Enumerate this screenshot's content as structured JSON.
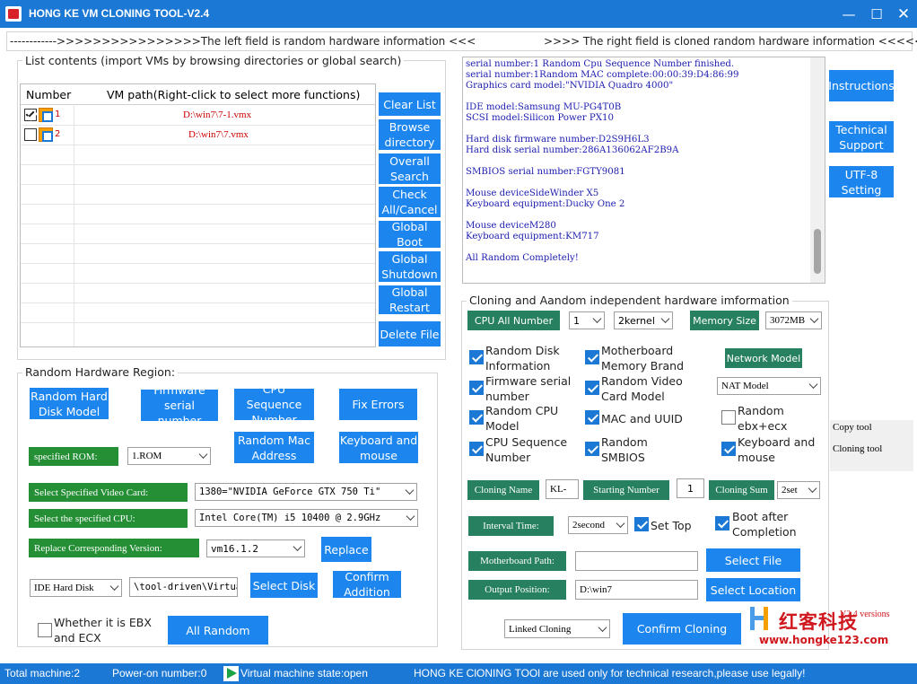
{
  "titlebar": {
    "title": "HONG KE VM CLONING TOOL-V2.4"
  },
  "banner": {
    "left": "------------>>>>>>>>>>>>>>>>The left field is random hardware information <<<",
    "right": ">>>> The right field is cloned random hardware information <<<<<<"
  },
  "list_section": {
    "legend": "List contents (import VMs by browsing directories or global search)",
    "col_number": "Number",
    "col_path": "VM path(Right-click to select more functions)",
    "rows": [
      {
        "number": "1",
        "path": "D:\\win7\\7-1.vmx",
        "checked": true
      },
      {
        "number": "2",
        "path": "D:\\win7\\7.vmx",
        "checked": false
      }
    ]
  },
  "list_buttons": {
    "clear": "Clear List",
    "browse": "Browse directory",
    "search": "Overall Search",
    "check": "Check All/Cancel",
    "boot": "Global Boot",
    "shutdown": "Global Shutdown",
    "restart": "Global Restart",
    "delete": "Delete File"
  },
  "log": {
    "text": "serial number:1 Random Cpu Sequence Number finished.\nserial number:1Random MAC complete:00:00:39:D4:86:99\nGraphics card model:\"NVIDIA Quadro 4000\"\n\nIDE model:Samsung MU-PG4T0B\nSCSI model:Silicon Power PX10\n\nHard disk firmware number:D2S9H6L3\nHard disk serial number:286A136062AF2B9A\n\nSMBIOS serial number:FGTY9081\n\nMouse deviceSideWinder X5\nKeyboard equipment:Ducky One 2\n\nMouse deviceM280\nKeyboard equipment:KM717\n\nAll Random Completely!"
  },
  "side_buttons": {
    "instructions": "Instructions",
    "support": "Technical Support",
    "utf8": "UTF-8 Setting"
  },
  "side_list": {
    "copy": "Copy tool",
    "cloning": "Cloning tool"
  },
  "random_section": {
    "legend": "Random Hardware Region:",
    "hard_disk": "Random Hard Disk Model",
    "firmware": "Firmware serial number",
    "cpu_seq": "CPU Sequence Number",
    "fix": "Fix Errors",
    "rom_label": "specified ROM:",
    "rom_value": "1.ROM",
    "mac": "Random Mac Address",
    "keyboard": "Keyboard and mouse",
    "video_label": "Select Specified Video Card:",
    "video_value": "1380=\"NVIDIA GeForce GTX 750 Ti\"",
    "cpu_label": "Select the specified CPU:",
    "cpu_value": "Intel Core(TM) i5 10400 @ 2.9GHz",
    "version_label": "Replace Corresponding Version:",
    "version_value": "vm16.1.2",
    "replace": "Replace",
    "disk_type": "IDE Hard Disk",
    "disk_path": "\\tool-driven\\Virtual",
    "select_disk": "Select Disk",
    "confirm_add": "Confirm Addition",
    "ebx_label": "Whether it is EBX and ECX",
    "all_random": "All Random"
  },
  "clone_section": {
    "legend": "Cloning and Aandom independent hardware imformation",
    "cpu_label": "CPU All Number",
    "cpu_count": "1",
    "kernel": "2kernel",
    "memory_label": "Memory Size",
    "memory_value": "3072MB",
    "checks": {
      "rand_disk": "Random Disk Information",
      "mb_mem": "Motherboard Memory Brand",
      "network_model": "Network Model",
      "fw_serial": "Firmware serial number",
      "rand_video": "Random Video Card Model",
      "nat": "NAT Model",
      "rand_cpu": "Random CPU Model",
      "mac_uuid": "MAC and UUID",
      "ebx": "Random ebx+ecx",
      "cpu_seq": "CPU Sequence Number",
      "smbios": "Random SMBIOS",
      "kbd": "Keyboard and mouse"
    },
    "clone_name_label": "Cloning Name",
    "clone_name": "KL-",
    "start_label": "Starting Number",
    "start": "1",
    "sum_label": "Cloning Sum",
    "sum": "2set",
    "interval_label": "Interval Time:",
    "interval": "2second",
    "set_top": "Set Top",
    "boot_after": "Boot after Completion",
    "mb_path_label": "Motherboard Path:",
    "mb_path": "",
    "select_file": "Select File",
    "output_label": "Output Position:",
    "output": "D:\\win7",
    "select_loc": "Select Location",
    "linked": "Linked Cloning",
    "confirm": "Confirm Cloning",
    "version": "V2.4 versions"
  },
  "watermark": {
    "brand": "红客科技",
    "url": "www.hongke123.com"
  },
  "statusbar": {
    "total": "Total machine:2",
    "power": "Power-on number:0",
    "state": "Virtual machine state:open",
    "notice": "HONG KE ClONING TOOl are used only for technical research,please use legally!"
  },
  "colors": {
    "accent": "#1b78d4",
    "button": "#1c86ee",
    "label_green": "#248f35",
    "label_teal": "#27805f",
    "version_red": "#d0171d"
  }
}
